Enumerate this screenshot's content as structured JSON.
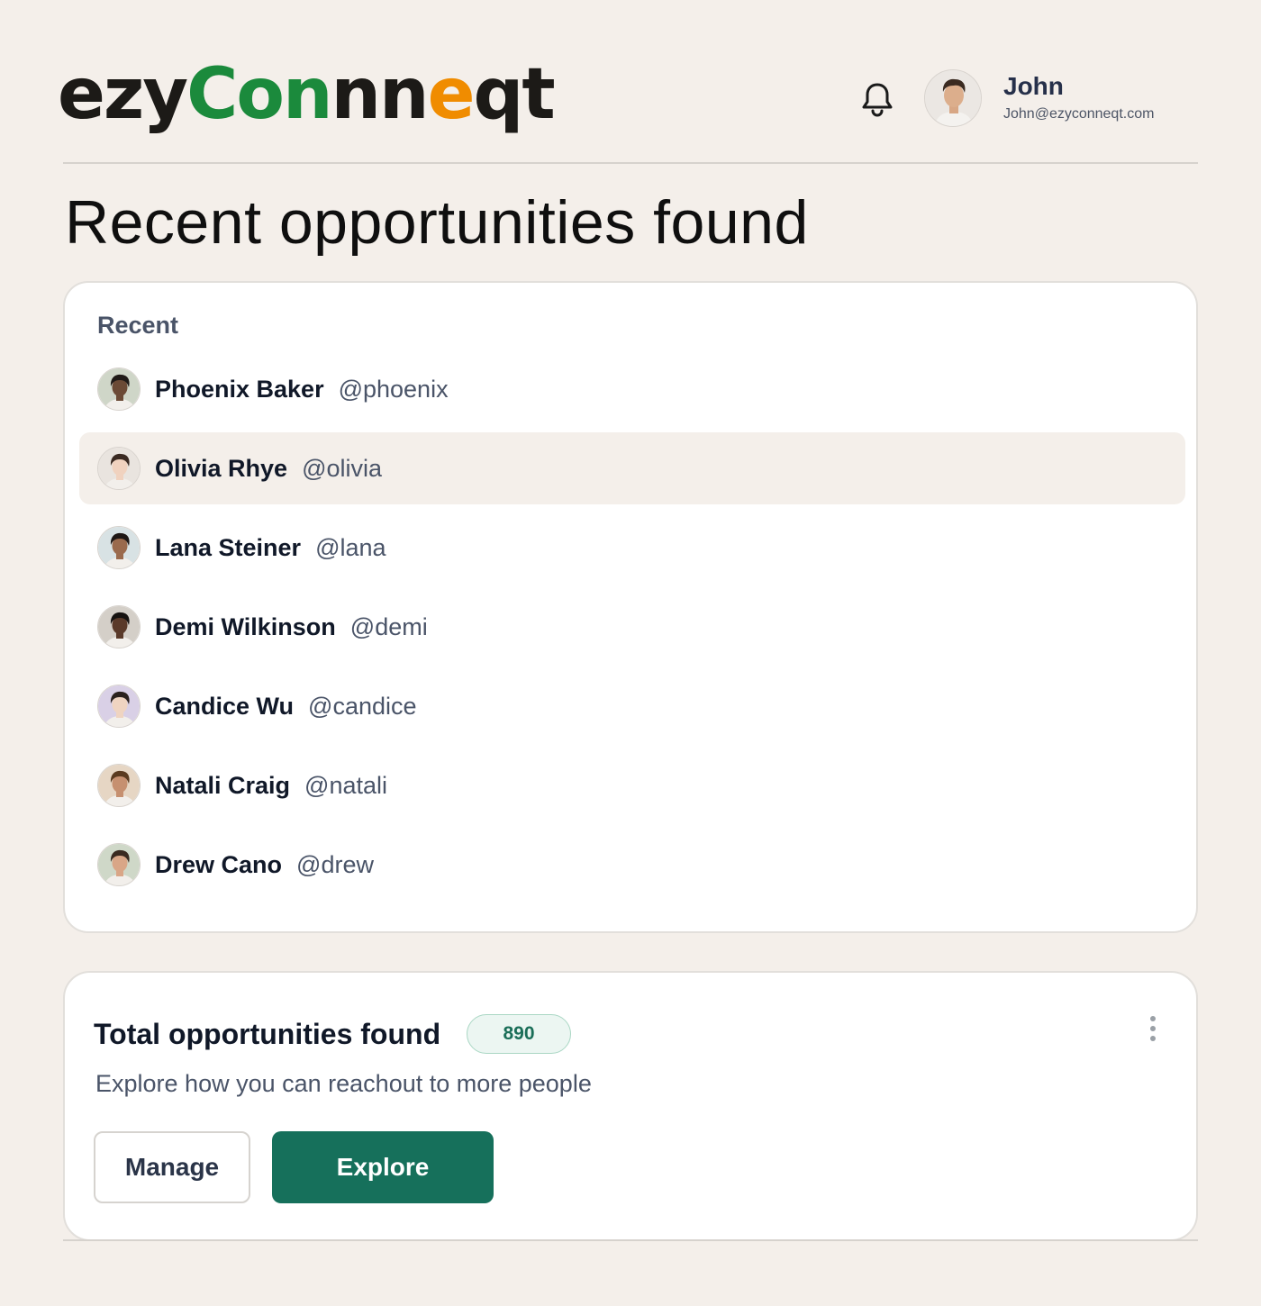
{
  "header": {
    "logo": {
      "part1": "ezy",
      "part2": "Con",
      "part3": "nn",
      "part4": "e",
      "part5": "q",
      "part6": "t"
    },
    "bell_icon": "bell-icon",
    "user": {
      "name": "John",
      "email": "John@ezyconneqt.com"
    }
  },
  "page": {
    "title": "Recent opportunities found"
  },
  "recent": {
    "label": "Recent",
    "items": [
      {
        "name": "Phoenix Baker",
        "handle": "@phoenix",
        "skin": "#6b4a35",
        "bg": "#cfd6c8",
        "hair": "#1f1a17"
      },
      {
        "name": "Olivia Rhye",
        "handle": "@olivia",
        "skin": "#f0d2bf",
        "bg": "#e9e4df",
        "hair": "#3a2a22"
      },
      {
        "name": "Lana Steiner",
        "handle": "@lana",
        "skin": "#9a6a4d",
        "bg": "#d8e2e4",
        "hair": "#1e1715"
      },
      {
        "name": "Demi Wilkinson",
        "handle": "@demi",
        "skin": "#5a3a2a",
        "bg": "#d4cfc8",
        "hair": "#161210"
      },
      {
        "name": "Candice Wu",
        "handle": "@candice",
        "skin": "#efd4c1",
        "bg": "#d9d0e6",
        "hair": "#2a211d"
      },
      {
        "name": "Natali Craig",
        "handle": "@natali",
        "skin": "#c69070",
        "bg": "#e6d6c4",
        "hair": "#5a3a1f"
      },
      {
        "name": "Drew Cano",
        "handle": "@drew",
        "skin": "#d9a687",
        "bg": "#cfd8c8",
        "hair": "#3a2a20"
      }
    ],
    "active_index": 1
  },
  "total": {
    "title": "Total opportunities found",
    "count": "890",
    "description": "Explore how you can reachout to more people",
    "manage_label": "Manage",
    "explore_label": "Explore",
    "more_icon": "more-vertical-icon"
  },
  "colors": {
    "background": "#f4efea",
    "accent": "#16705b",
    "logo_green": "#1b8a3c",
    "logo_orange": "#f08c00"
  }
}
